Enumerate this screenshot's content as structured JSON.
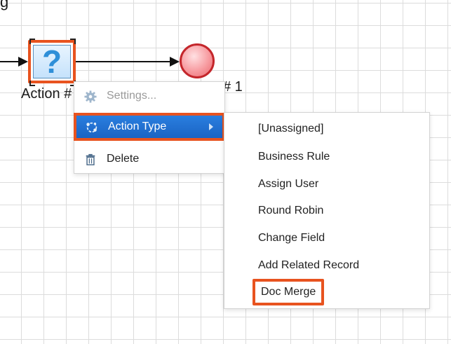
{
  "canvas": {
    "top_label_fragment": "g",
    "action_node_label": "Action #",
    "end_event_label_fragment": "# 1",
    "action_node_glyph": "?",
    "action_node_icon": "question-mark-icon",
    "end_event_icon": "end-event-circle-icon"
  },
  "context_menu": {
    "items": [
      {
        "label": "Settings...",
        "icon": "gear-icon",
        "disabled": true
      },
      {
        "label": "Action Type",
        "icon": "process-action-icon",
        "selected": true,
        "has_submenu": true
      },
      {
        "label": "Delete",
        "icon": "trash-icon"
      }
    ]
  },
  "submenu": {
    "items": [
      {
        "label": "[Unassigned]"
      },
      {
        "label": "Business Rule"
      },
      {
        "label": "Assign User"
      },
      {
        "label": "Round Robin"
      },
      {
        "label": "Change Field"
      },
      {
        "label": "Add Related Record"
      },
      {
        "label": "Doc Merge",
        "highlighted": true
      }
    ]
  },
  "colors": {
    "highlight_outline": "#e8531f",
    "selected_item_bg": "#1a6fd6",
    "action_glyph": "#2f8fd8",
    "end_event": "#c4262b"
  }
}
